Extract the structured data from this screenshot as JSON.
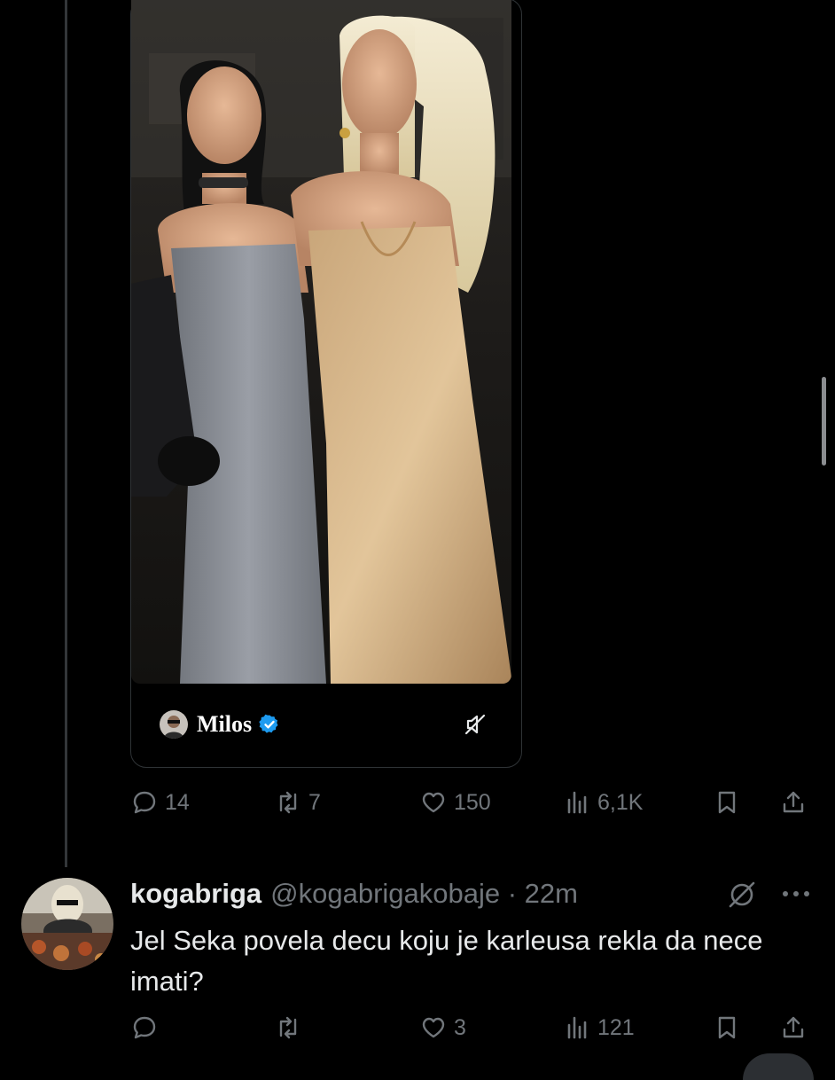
{
  "embedded": {
    "author_name": "Milos"
  },
  "tweet_actions": {
    "replies": "14",
    "reposts": "7",
    "likes": "150",
    "views": "6,1K"
  },
  "reply": {
    "name": "kogabriga",
    "handle_time": "@kogabrigakobaje · 22m",
    "text": "Jel Seka povela decu koju je karleusa rekla da nece imati?",
    "actions": {
      "replies": "",
      "reposts": "",
      "likes": "3",
      "views": "121"
    }
  },
  "colors": {
    "background": "#000000",
    "text": "#e7e9ea",
    "muted": "#71767b",
    "verified": "#1d9bf0"
  }
}
